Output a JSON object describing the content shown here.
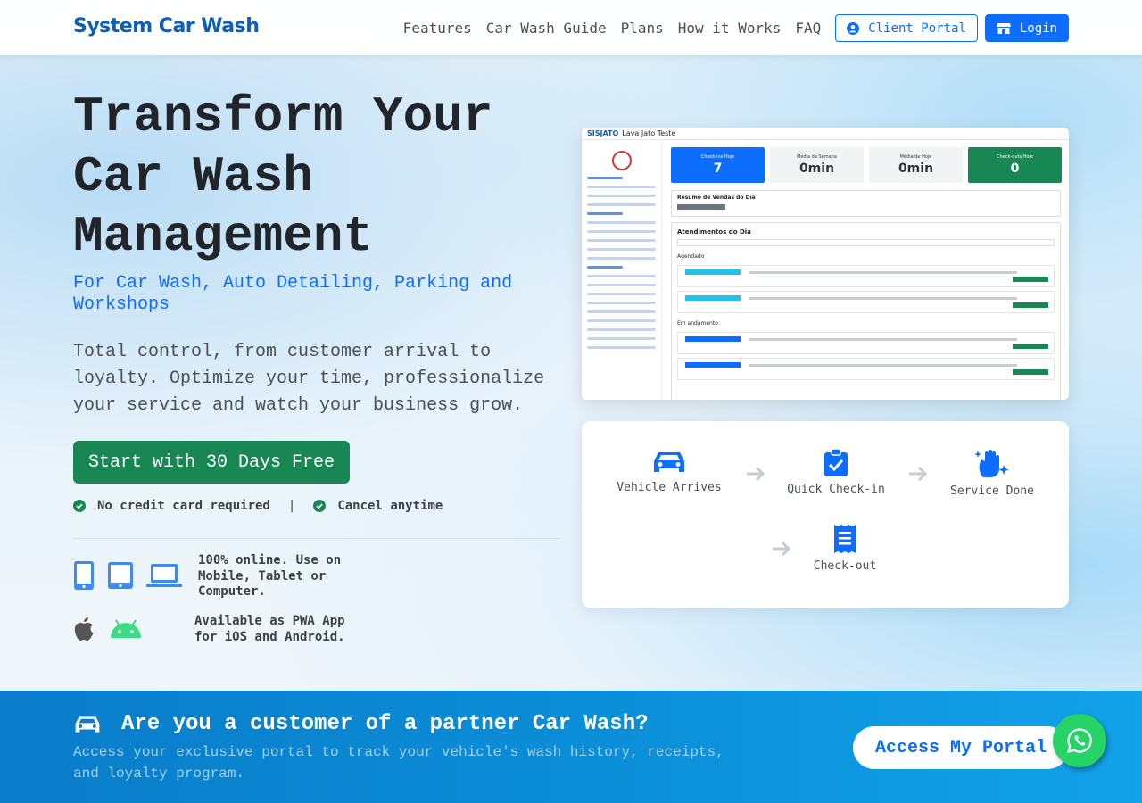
{
  "nav": {
    "brand": "System Car Wash",
    "links": [
      "Features",
      "Car Wash Guide",
      "Plans",
      "How it Works",
      "FAQ"
    ],
    "client_portal": "Client Portal",
    "login": "Login"
  },
  "hero": {
    "title": "Transform Your Car Wash Management",
    "subtitle": "For Car Wash, Auto Detailing, Parking and Workshops",
    "description": "Total control, from customer arrival to loyalty. Optimize your time, professionalize your service and watch your business grow.",
    "cta": "Start with 30 Days Free",
    "check1": "No credit card required",
    "separator": "|",
    "check2": "Cancel anytime",
    "online_text": "100% online. Use on Mobile, Tablet or Computer.",
    "pwa_text": "Available as PWA App for iOS and Android."
  },
  "screenshot": {
    "logo": "SISJATO",
    "company": "Lava Jato Teste",
    "stats": [
      {
        "label": "Check-ins Hoje",
        "value": "7"
      },
      {
        "label": "Média da Semana",
        "value": "0min"
      },
      {
        "label": "Média de Hoje",
        "value": "0min"
      },
      {
        "label": "Check-outs Hoje",
        "value": "0"
      }
    ],
    "sales_title": "Resumo de Vendas do Dia",
    "service_title": "Atendimentos do Dia",
    "group1": "Agendado",
    "group2": "Em andamento"
  },
  "flow": {
    "steps": [
      "Vehicle Arrives",
      "Quick Check-in",
      "Service Done",
      "Check-out"
    ]
  },
  "banner": {
    "title": "Are you a customer of a partner Car Wash?",
    "description": "Access your exclusive portal to track your vehicle's wash history, receipts, and loyalty program.",
    "button": "Access My Portal"
  },
  "colors": {
    "primary": "#0d6efd",
    "success": "#198754",
    "brand": "#0d5fb8",
    "whatsapp": "#25d366"
  }
}
